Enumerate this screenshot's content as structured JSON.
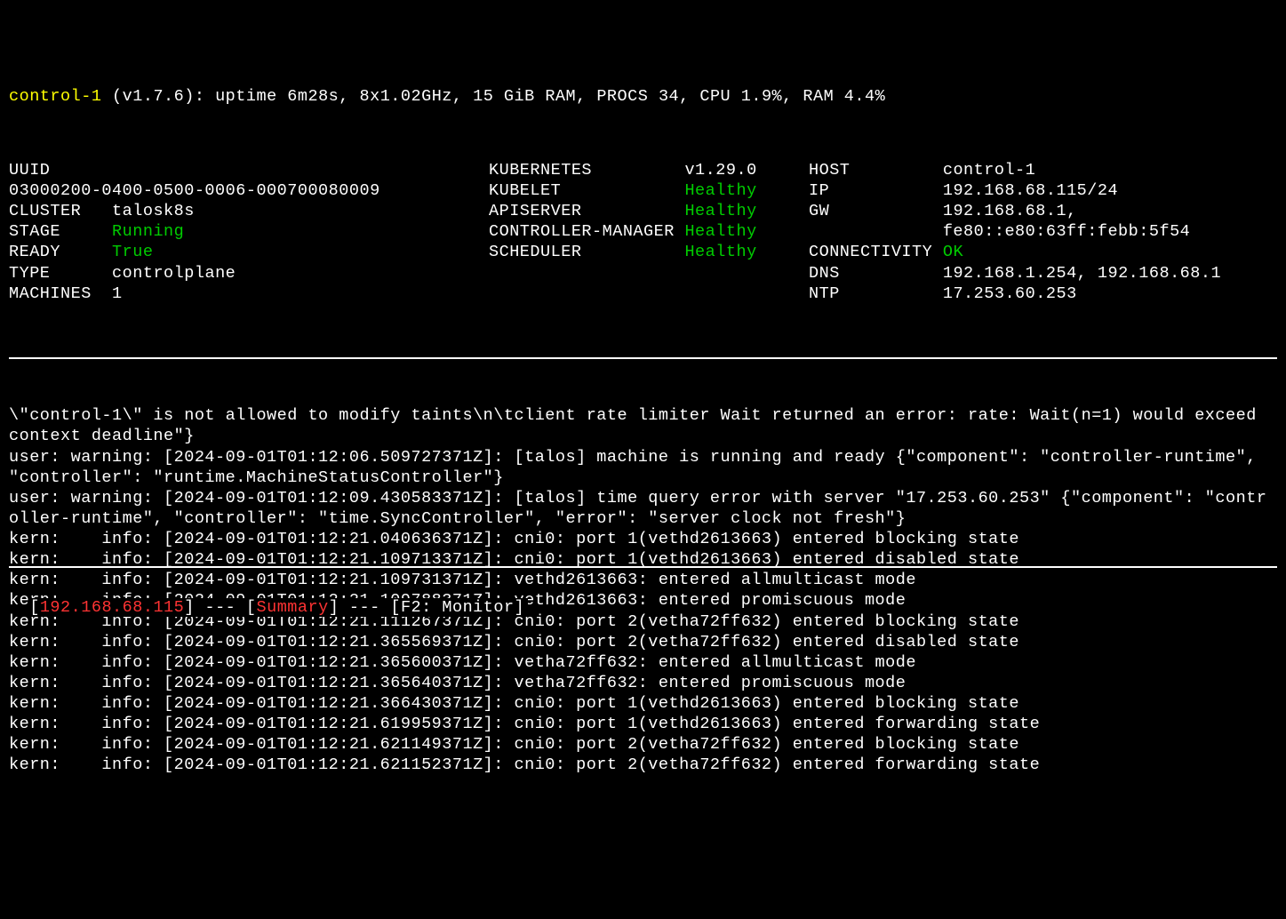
{
  "header": {
    "hostname": "control-1",
    "version": "(v1.7.6)",
    "stats": ": uptime 6m28s, 8x1.02GHz, 15 GiB RAM, PROCS 34, CPU 1.9%, RAM 4.4%"
  },
  "col1": {
    "uuid_label": "UUID",
    "uuid_value": "03000200-0400-0500-0006-000700080009",
    "cluster_label": "CLUSTER",
    "cluster_value": "talosk8s",
    "stage_label": "STAGE",
    "stage_value": "Running",
    "ready_label": "READY",
    "ready_value": "True",
    "type_label": "TYPE",
    "type_value": "controlplane",
    "machines_label": "MACHINES",
    "machines_value": "1"
  },
  "col2": {
    "kubernetes_label": "KUBERNETES",
    "kubernetes_value": "v1.29.0",
    "kubelet_label": "KUBELET",
    "kubelet_value": "Healthy",
    "apiserver_label": "APISERVER",
    "apiserver_value": "Healthy",
    "ctrlmgr_label": "CONTROLLER-MANAGER",
    "ctrlmgr_value": "Healthy",
    "scheduler_label": "SCHEDULER",
    "scheduler_value": "Healthy"
  },
  "col3": {
    "host_label": "HOST",
    "host_value": "control-1",
    "ip_label": "IP",
    "ip_value": "192.168.68.115/24",
    "gw_label": "GW",
    "gw_value": "192.168.68.1,",
    "gw2_value": "fe80::e80:63ff:febb:5f54",
    "conn_label": "CONNECTIVITY",
    "conn_value": "OK",
    "dns_label": "DNS",
    "dns_value": "192.168.1.254, 192.168.68.1",
    "ntp_label": "NTP",
    "ntp_value": "17.253.60.253"
  },
  "log": {
    "line0": "\\\"control-1\\\" is not allowed to modify taints\\n\\tclient rate limiter Wait returned an error: rate: Wait(n=1) would exceed context deadline\"}",
    "line1": "user: warning: [2024-09-01T01:12:06.509727371Z]: [talos] machine is running and ready {\"component\": \"controller-runtime\", \"controller\": \"runtime.MachineStatusController\"}",
    "line2": "user: warning: [2024-09-01T01:12:09.430583371Z]: [talos] time query error with server \"17.253.60.253\" {\"component\": \"controller-runtime\", \"controller\": \"time.SyncController\", \"error\": \"server clock not fresh\"}",
    "line3": "kern:    info: [2024-09-01T01:12:21.040636371Z]: cni0: port 1(vethd2613663) entered blocking state",
    "line4": "kern:    info: [2024-09-01T01:12:21.109713371Z]: cni0: port 1(vethd2613663) entered disabled state",
    "line5": "kern:    info: [2024-09-01T01:12:21.109731371Z]: vethd2613663: entered allmulticast mode",
    "line6": "kern:    info: [2024-09-01T01:12:21.109788371Z]: vethd2613663: entered promiscuous mode",
    "line7": "kern:    info: [2024-09-01T01:12:21.111267371Z]: cni0: port 2(vetha72ff632) entered blocking state",
    "line8": "kern:    info: [2024-09-01T01:12:21.365569371Z]: cni0: port 2(vetha72ff632) entered disabled state",
    "line9": "kern:    info: [2024-09-01T01:12:21.365600371Z]: vetha72ff632: entered allmulticast mode",
    "line10": "kern:    info: [2024-09-01T01:12:21.365640371Z]: vetha72ff632: entered promiscuous mode",
    "line11": "kern:    info: [2024-09-01T01:12:21.366430371Z]: cni0: port 1(vethd2613663) entered blocking state",
    "line12": "kern:    info: [2024-09-01T01:12:21.619959371Z]: cni0: port 1(vethd2613663) entered forwarding state",
    "line13": "kern:    info: [2024-09-01T01:12:21.621149371Z]: cni0: port 2(vetha72ff632) entered blocking state",
    "line14": "kern:    info: [2024-09-01T01:12:21.621152371Z]: cni0: port 2(vetha72ff632) entered forwarding state"
  },
  "statusbar": {
    "ip": "192.168.68.115",
    "tab1": "Summary",
    "tab2": "F2: Monitor",
    "brkt_open": "[",
    "brkt_close": "]",
    "dash": " --- "
  }
}
